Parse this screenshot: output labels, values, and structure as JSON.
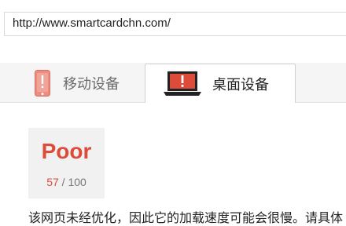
{
  "address_bar": {
    "url": "http://www.smartcardchn.com/"
  },
  "tabs": [
    {
      "label": "移动设备",
      "icon": "mobile-phone-icon",
      "active": false
    },
    {
      "label": "桌面设备",
      "icon": "laptop-icon",
      "active": true
    }
  ],
  "score": {
    "rating": "Poor",
    "value": "57",
    "separator": "/",
    "max": "100"
  },
  "description": "该网页未经优化，因此它的加载速度可能会很慢。请具体",
  "colors": {
    "alert_red": "#dd4b39",
    "tab_bar_bg": "#f5f5f5",
    "score_card_bg": "#f1f1f1"
  }
}
